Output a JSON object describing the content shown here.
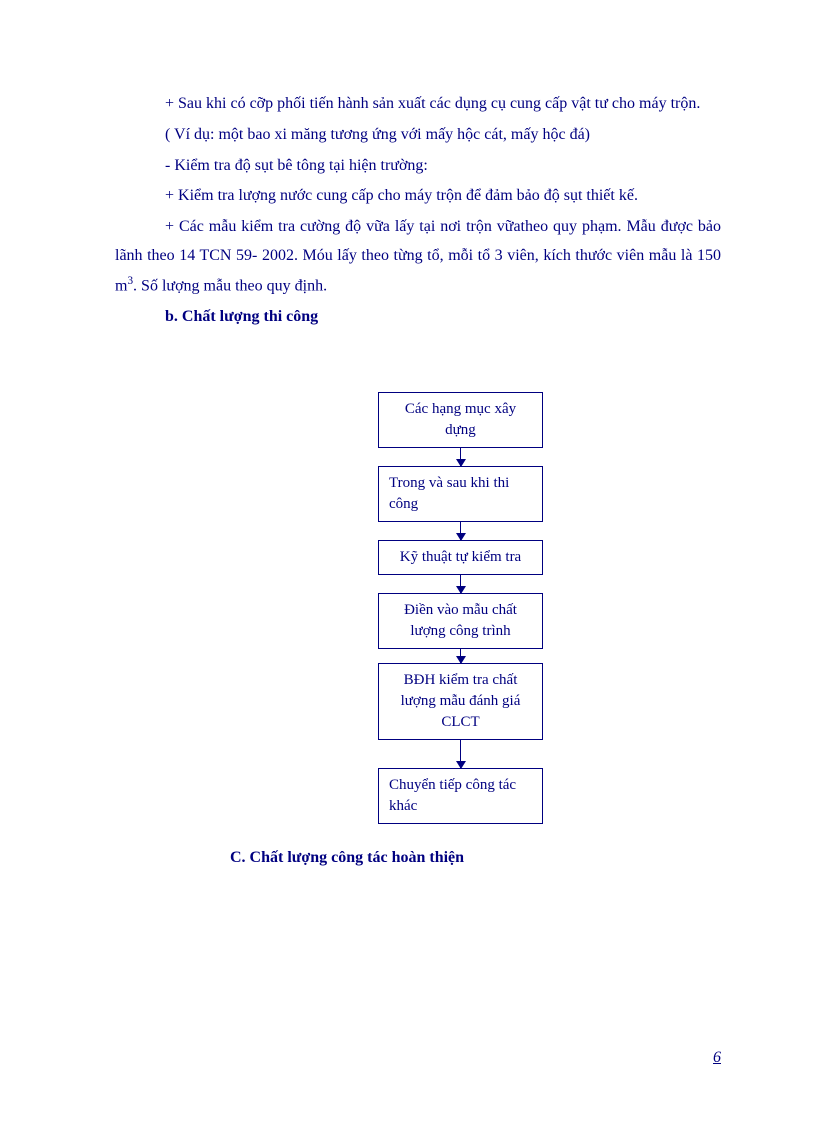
{
  "paragraphs": {
    "p1": "+ Sau khi có cỡp phối tiến hành sản xuất các dụng cụ cung cấp vật tư cho máy trộn.",
    "p2": "( Ví dụ: một bao xi măng tương ứng với mấy hộc cát, mấy hộc đá)",
    "p3": "- Kiểm tra độ sụt bê tông tại hiện trường:",
    "p4": "+ Kiểm tra lượng nước cung cấp cho máy trộn để đảm bảo độ sụt thiết kế.",
    "p5_pre": "+ Các mẫu kiểm tra cường độ vữa lấy tại nơi trộn vữatheo quy phạm. Mẫu được bảo lãnh theo 14 TCN 59- 2002. Móu lấy theo từng tổ, mỗi tổ 3 viên, kích thước viên mẫu là 150 m",
    "p5_sup": "3",
    "p5_post": ". Số lượng mẫu theo quy định."
  },
  "headings": {
    "b": "b. Chất lượng thi công",
    "c": "C. Chất lượng công tác hoàn thiện"
  },
  "flowchart": {
    "box1": "Các hạng mục xây dựng",
    "box2": "Trong và sau khi thi công",
    "box3": "Kỹ thuật tự kiểm tra",
    "box4": "Điền vào mẫu chất lượng công trình",
    "box5": "BĐH kiểm tra chất lượng mẫu đánh giá CLCT",
    "box6": "Chuyển tiếp công tác khác"
  },
  "page_number": "6"
}
